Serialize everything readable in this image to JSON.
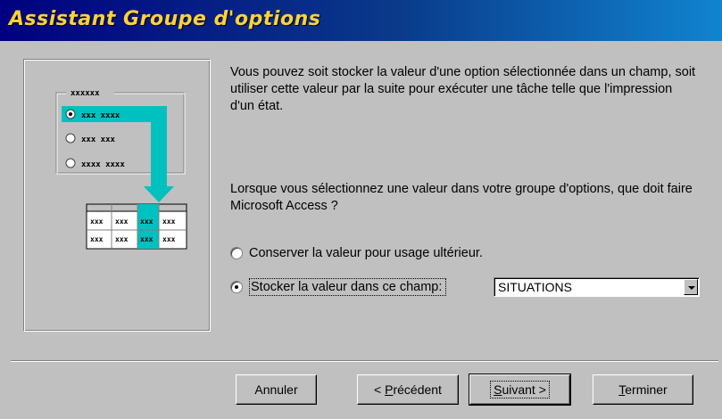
{
  "window": {
    "title": "Assistant Groupe d'options"
  },
  "illustration": {
    "group_label": "xxxxxx",
    "options": [
      "xxx xxxx",
      "xxx xxx",
      "xxxx xxxx"
    ],
    "table_cells": [
      "xxx",
      "xxx",
      "xxx",
      "xxx"
    ],
    "accent_color": "#00c0c0"
  },
  "description": "Vous pouvez soit stocker la valeur d'une option sélectionnée dans un champ, soit utiliser cette valeur par la suite pour exécuter une tâche telle que l'impression d'un état.",
  "question": "Lorsque vous sélectionnez une valeur dans votre groupe d'options, que doit faire Microsoft Access ?",
  "options": {
    "keep": {
      "label": "Conserver la valeur pour usage ultérieur.",
      "selected": false
    },
    "store": {
      "label": "Stocker la valeur dans ce champ:",
      "selected": true
    }
  },
  "field_combo": {
    "value": "SITUATIONS"
  },
  "buttons": {
    "cancel": "Annuler",
    "back_prefix": "< ",
    "back_mnemonic": "P",
    "back_rest": "récédent",
    "next_mnemonic": "S",
    "next_rest": "uivant >",
    "finish_mnemonic": "T",
    "finish_rest": "erminer"
  }
}
